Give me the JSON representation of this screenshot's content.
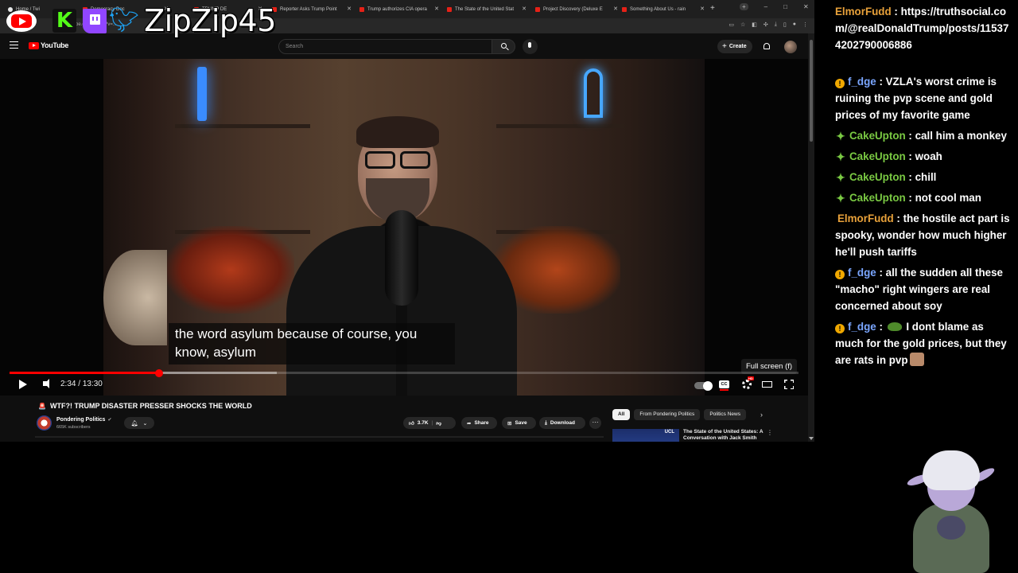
{
  "browser": {
    "tabs": [
      {
        "label": "Home / Twi",
        "icon": "x-icon"
      },
      {
        "label": "Democracy Doc",
        "icon": "youtube-icon"
      },
      {
        "label": "TRUMP DE",
        "icon": "youtube-icon"
      },
      {
        "label": "Reporter Asks Trump Point",
        "icon": "youtube-icon"
      },
      {
        "label": "Trump authorizes CIA opera",
        "icon": "youtube-icon"
      },
      {
        "label": "The State of the United Stat",
        "icon": "youtube-icon"
      },
      {
        "label": "Project Discovery (Deluxe E",
        "icon": "youtube-icon"
      },
      {
        "label": "Something About Us - rain",
        "icon": "youtube-icon"
      }
    ],
    "new_tab_label": "+",
    "address_text": "tube.com/watch?v=...",
    "close_glyph": "✕"
  },
  "overlay": {
    "streamer_name": "ZipZip45",
    "kick_letter": "K"
  },
  "youtube": {
    "logo_text": "YouTube",
    "search_placeholder": "Search",
    "create_label": "Create",
    "video": {
      "caption_text": "the word asylum because of course, you know, asylum",
      "fullscreen_tooltip": "Full screen (f)",
      "current_time": "2:34",
      "duration": "13:30",
      "progress_fraction": 0.19
    },
    "title": "WTF?! TRUMP DISASTER PRESSER SHOCKS THE WORLD",
    "title_emoji": "🚨",
    "channel": {
      "name": "Pondering Politics",
      "subscribers": "665K subscribers"
    },
    "actions": {
      "likes": "3.7K",
      "share": "Share",
      "save": "Save",
      "download": "Download",
      "more": "···"
    },
    "chips": [
      "All",
      "From Pondering Politics",
      "Politics News"
    ],
    "recommendation": {
      "thumb_text": "UCL",
      "title": "The State of the United States: A Conversation with Jack Smith"
    }
  },
  "chat": {
    "messages": [
      {
        "user": "ElmorFudd",
        "badge": "",
        "text": "https://truthsocial.com/@realDonaldTrump/posts/115374202790006886"
      },
      {
        "user": "f_dge",
        "badge": "!",
        "text": "VZLA's worst crime is ruining the pvp scene and gold prices of my favorite game"
      },
      {
        "user": "CakeUpton",
        "badge": "✦",
        "text": "call him a monkey"
      },
      {
        "user": "CakeUpton",
        "badge": "✦",
        "text": "woah"
      },
      {
        "user": "CakeUpton",
        "badge": "✦",
        "text": "chill"
      },
      {
        "user": "CakeUpton",
        "badge": "✦",
        "text": "not cool man"
      },
      {
        "user": "ElmorFudd",
        "badge": "",
        "text": "the hostile act part is spooky, wonder how much higher he'll push tariffs"
      },
      {
        "user": "f_dge",
        "badge": "!",
        "text": "all the sudden all these \"macho\" right wingers are real concerned about soy"
      },
      {
        "user": "f_dge",
        "badge": "!",
        "text": "I dont blame as much for the gold prices, but they are rats in pvp"
      }
    ],
    "separator": " : "
  }
}
